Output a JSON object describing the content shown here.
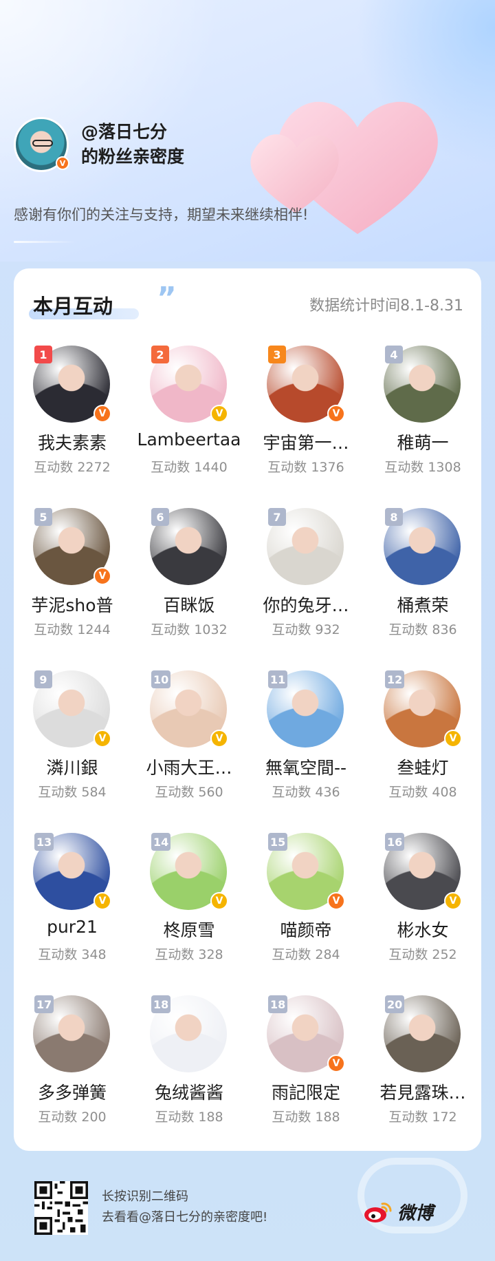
{
  "profile": {
    "name": "@落日七分",
    "subtitle": "的粉丝亲密度",
    "thanks": "感谢有你们的关注与支持，期望未来继续相伴!"
  },
  "card": {
    "title": "本月互动",
    "stat_time": "数据统计时间8.1-8.31"
  },
  "colors": {
    "rank_top1": "#f24a4a",
    "rank_top2": "#f46a3c",
    "rank_top3": "#f7871c",
    "rank_other": "#aeb7cc",
    "badge_orange": "#f7731c",
    "badge_gold": "#f5b400"
  },
  "fans": [
    {
      "rank": "1",
      "name": "我夫素素",
      "count": "互动数 2272",
      "badge": "orange",
      "avatar": "#2b2b33"
    },
    {
      "rank": "2",
      "name": "Lambeertaa",
      "count": "互动数 1440",
      "badge": "gold",
      "avatar": "#f0b7c8"
    },
    {
      "rank": "3",
      "name": "宇宙第一…",
      "count": "互动数 1376",
      "badge": "orange",
      "avatar": "#b74a2c"
    },
    {
      "rank": "4",
      "name": "稚萌一",
      "count": "互动数 1308",
      "badge": "",
      "avatar": "#5f6b4a"
    },
    {
      "rank": "5",
      "name": "芋泥sho普",
      "count": "互动数 1244",
      "badge": "orange",
      "avatar": "#6a5640"
    },
    {
      "rank": "6",
      "name": "百眯饭",
      "count": "互动数 1032",
      "badge": "",
      "avatar": "#3a3a3f"
    },
    {
      "rank": "7",
      "name": "你的兔牙…",
      "count": "互动数 932",
      "badge": "",
      "avatar": "#d9d6cf"
    },
    {
      "rank": "8",
      "name": "桶煮荣",
      "count": "互动数 836",
      "badge": "",
      "avatar": "#3f63a8"
    },
    {
      "rank": "9",
      "name": "潾川銀",
      "count": "互动数 584",
      "badge": "gold",
      "avatar": "#dcdcdc"
    },
    {
      "rank": "10",
      "name": "小雨大王…",
      "count": "互动数 560",
      "badge": "gold",
      "avatar": "#e8c9b4"
    },
    {
      "rank": "11",
      "name": "無氧空間--",
      "count": "互动数 436",
      "badge": "",
      "avatar": "#6fa9e0"
    },
    {
      "rank": "12",
      "name": "叁蛙灯",
      "count": "互动数 408",
      "badge": "gold",
      "avatar": "#c9763f"
    },
    {
      "rank": "13",
      "name": "pur21",
      "count": "互动数 348",
      "badge": "gold",
      "avatar": "#2e4fa0"
    },
    {
      "rank": "14",
      "name": "柊原雪",
      "count": "互动数 328",
      "badge": "gold",
      "avatar": "#9ad06a"
    },
    {
      "rank": "15",
      "name": "喵颜帝",
      "count": "互动数 284",
      "badge": "orange",
      "avatar": "#a7d36e"
    },
    {
      "rank": "16",
      "name": "彬水女",
      "count": "互动数 252",
      "badge": "gold",
      "avatar": "#4a4a4f"
    },
    {
      "rank": "17",
      "name": "多多弹簧",
      "count": "互动数 200",
      "badge": "",
      "avatar": "#8a7a70"
    },
    {
      "rank": "18",
      "name": "兔绒酱酱",
      "count": "互动数 188",
      "badge": "",
      "avatar": "#eef0f5"
    },
    {
      "rank": "18",
      "name": "雨記限定",
      "count": "互动数 188",
      "badge": "orange",
      "avatar": "#d8c0c4"
    },
    {
      "rank": "20",
      "name": "若見露珠…",
      "count": "互动数 172",
      "badge": "",
      "avatar": "#6a6155"
    }
  ],
  "footer": {
    "line1": "长按识别二维码",
    "line2": "去看看@落日七分的亲密度吧!",
    "brand": "微博",
    "brand_icon": "weibo-logo-icon"
  }
}
